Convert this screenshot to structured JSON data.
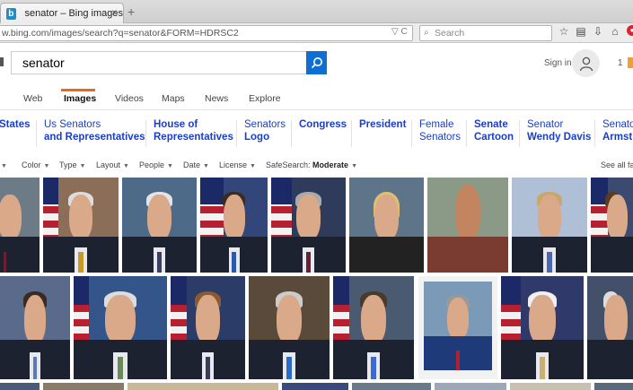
{
  "browser": {
    "tab_title": "senator – Bing images",
    "tab_favicon": "b",
    "tab_close": "×",
    "new_tab": "+",
    "url": "w.bing.com/images/search?q=senator&FORM=HDRSC2",
    "url_icons": "▽ C",
    "search_placeholder": "Search",
    "toolbar_icons": [
      "star-icon",
      "reading-list-icon",
      "download-icon",
      "home-icon",
      "pocket-icon"
    ]
  },
  "bing": {
    "query": "senator",
    "sign_in": "Sign in",
    "rewards_count": "1",
    "scopes": [
      "Web",
      "Images",
      "Videos",
      "Maps",
      "News",
      "Explore"
    ],
    "active_scope": "Images",
    "related": [
      {
        "l1": "States",
        "l2": ""
      },
      {
        "l1": "Us Senators",
        "l2": "and Representatives"
      },
      {
        "l1": "House of",
        "l2": "Representatives"
      },
      {
        "l1": "Senators",
        "l2": "Logo"
      },
      {
        "l1": "Congress",
        "l2": ""
      },
      {
        "l1": "President",
        "l2": ""
      },
      {
        "l1": "Female",
        "l2": "Senators"
      },
      {
        "l1": "Senate",
        "l2": "Cartoon"
      },
      {
        "l1": "Senator",
        "l2": "Wendy Davis"
      },
      {
        "l1": "Senato",
        "l2": "Armstr"
      }
    ],
    "filters": [
      "Color",
      "Type",
      "Layout",
      "People",
      "Date",
      "License"
    ],
    "safesearch_label": "SafeSearch:",
    "safesearch_value": "Moderate",
    "see_all": "See all fav"
  }
}
